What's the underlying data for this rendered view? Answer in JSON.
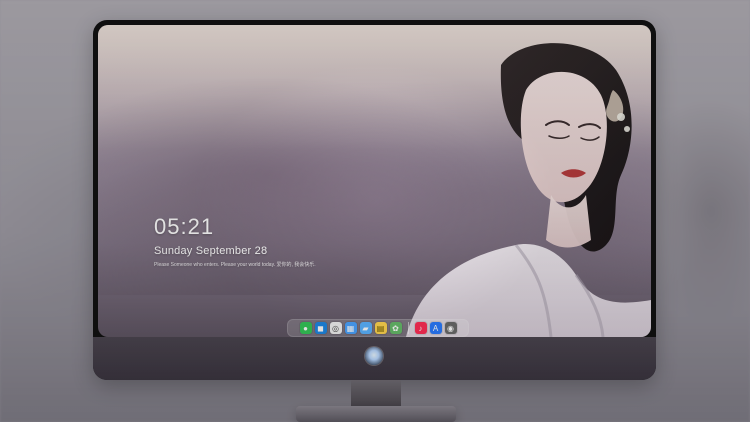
{
  "lock_screen": {
    "time": "05:21",
    "date": "Sunday September  28",
    "quote": "Please Someone who enters. Please your world today. 爱你的, 我会快乐."
  },
  "dock": {
    "icons": [
      {
        "name": "messages-icon",
        "color": "#35c759",
        "glyph": "●"
      },
      {
        "name": "finder-icon",
        "color": "#1e88e5",
        "glyph": "◼"
      },
      {
        "name": "safari-icon",
        "color": "#f2f2f2",
        "glyph": "◎"
      },
      {
        "name": "preview-icon",
        "color": "#4aa3ff",
        "glyph": "▦"
      },
      {
        "name": "final-cut-icon",
        "color": "#5bb3ff",
        "glyph": "▰"
      },
      {
        "name": "notes-icon",
        "color": "#ffd54f",
        "glyph": "▤"
      },
      {
        "name": "photos-icon",
        "color": "#66bb6a",
        "glyph": "✿"
      },
      {
        "name": "music-icon",
        "color": "#ff2d55",
        "glyph": "♪"
      },
      {
        "name": "app-store-icon",
        "color": "#2a7bff",
        "glyph": "A"
      },
      {
        "name": "camera-icon",
        "color": "#6b6b6b",
        "glyph": "◉"
      }
    ]
  },
  "colors": {
    "monitor_bezel": "#111111",
    "chin": "#3b3540"
  }
}
